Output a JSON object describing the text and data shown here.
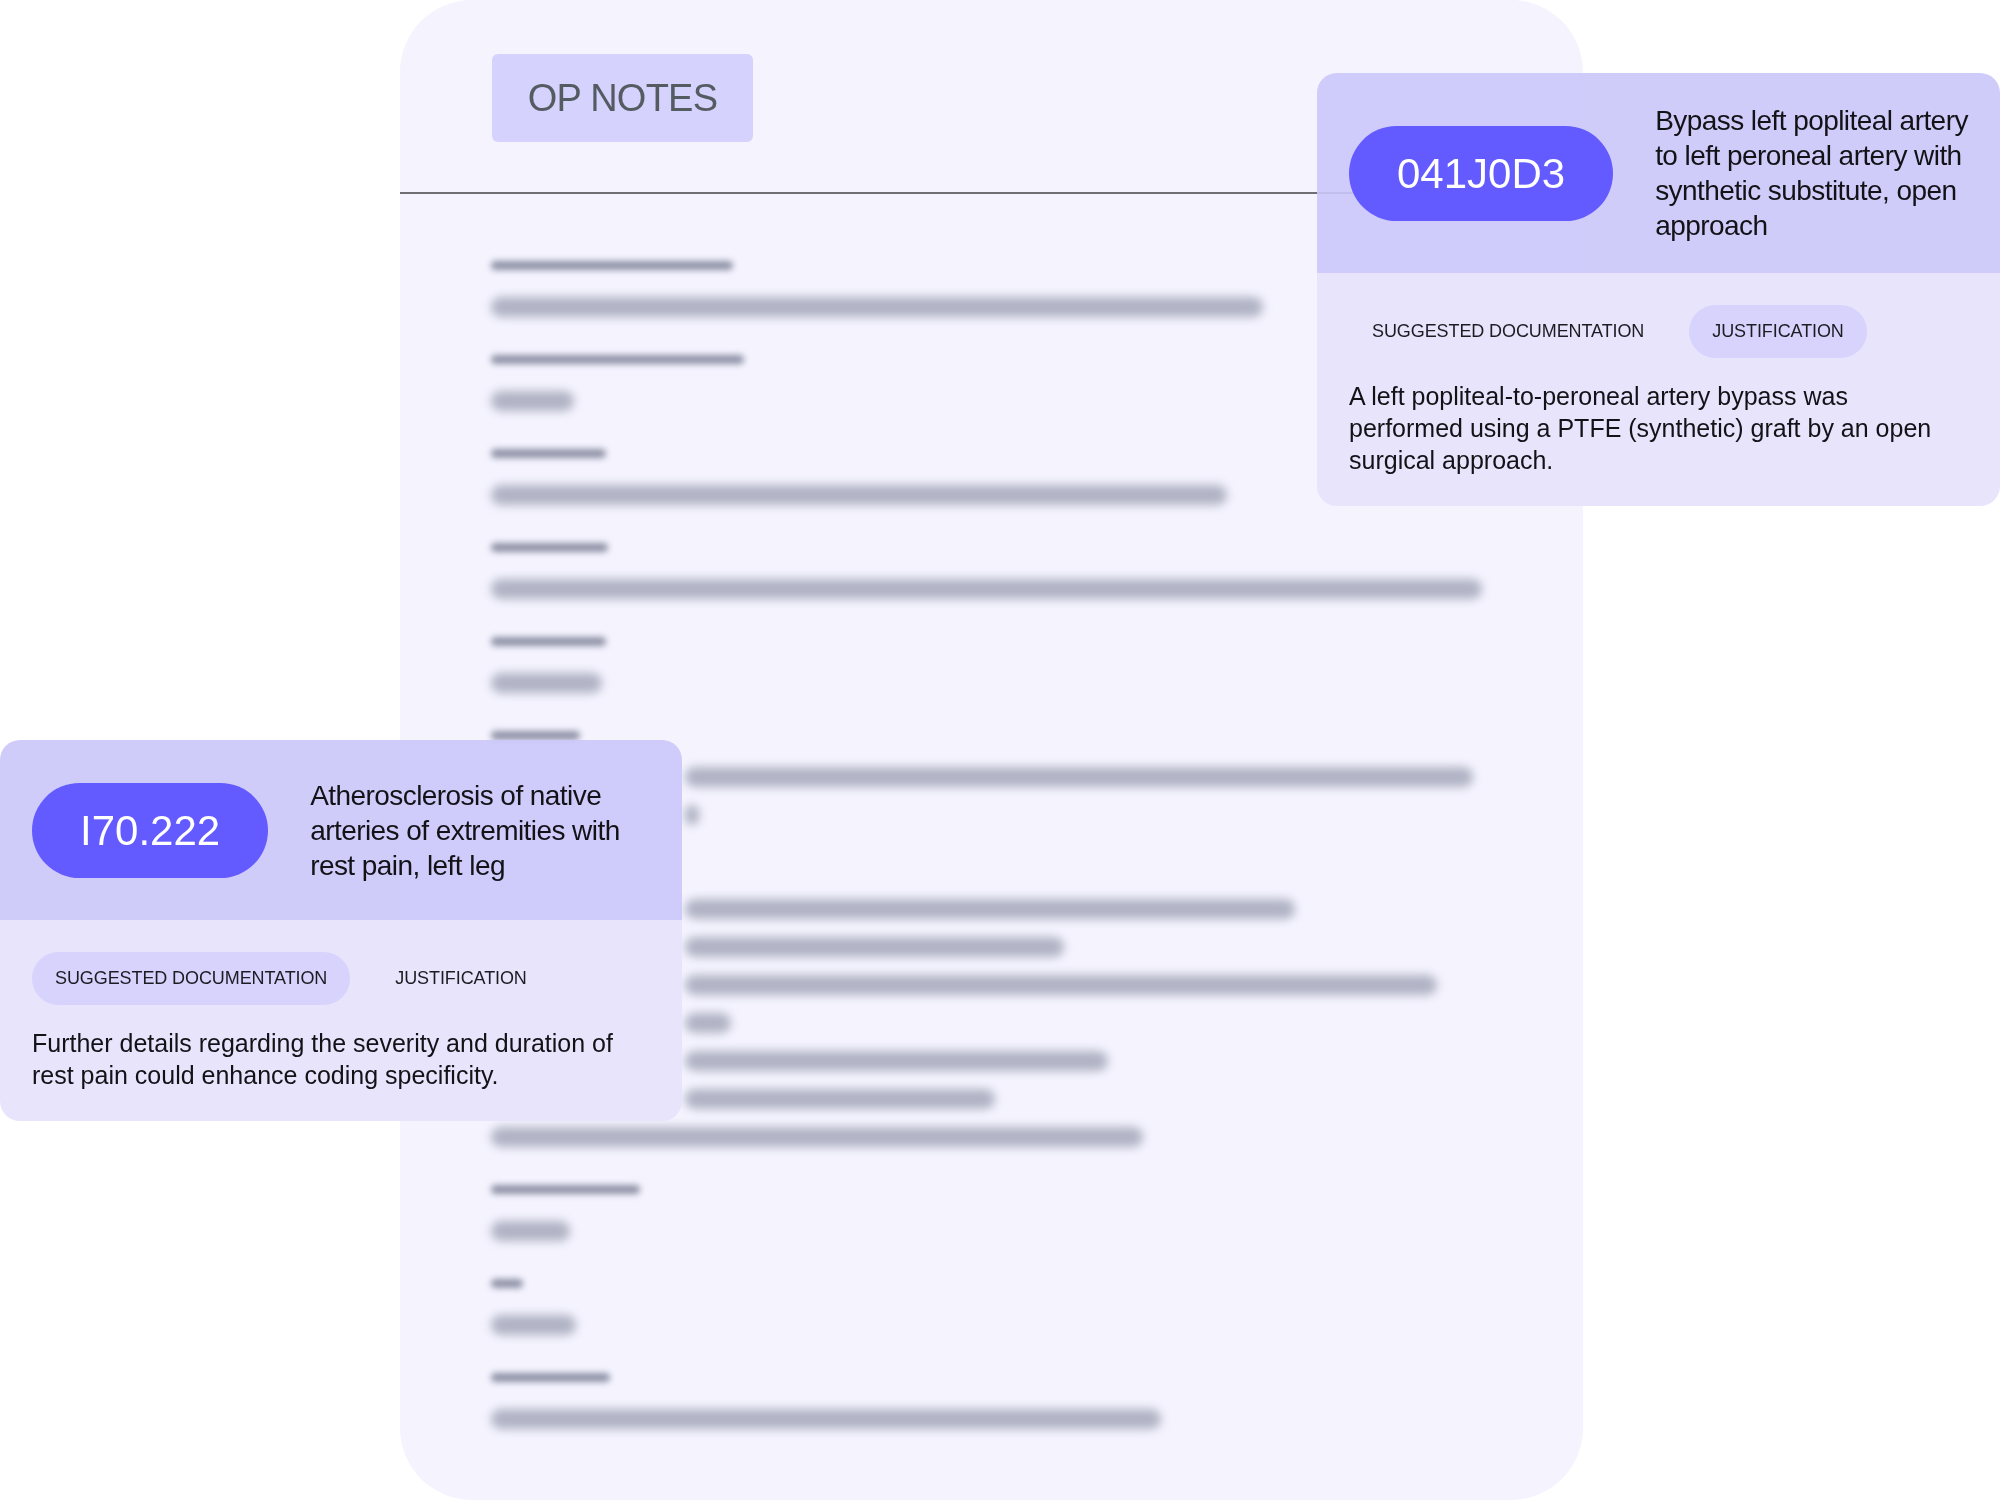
{
  "document": {
    "title": "OP NOTES"
  },
  "code_cards": [
    {
      "code": "041J0D3",
      "description": "Bypass left popliteal artery to left peroneal artery with synthetic substitute, open approach",
      "tabs": [
        {
          "label": "SUGGESTED DOCUMENTATION",
          "selected": false
        },
        {
          "label": "JUSTIFICATION",
          "selected": true
        }
      ],
      "content": "A left popliteal-to-peroneal artery bypass was performed using a PTFE (synthetic) graft by an open surgical approach."
    },
    {
      "code": "I70.222",
      "description": "Atherosclerosis of native arteries of extremities with rest pain, left leg",
      "tabs": [
        {
          "label": "SUGGESTED DOCUMENTATION",
          "selected": true
        },
        {
          "label": "JUSTIFICATION",
          "selected": false
        }
      ],
      "content": "Further details regarding the severity and duration of rest pain could enhance coding specificity."
    }
  ]
}
